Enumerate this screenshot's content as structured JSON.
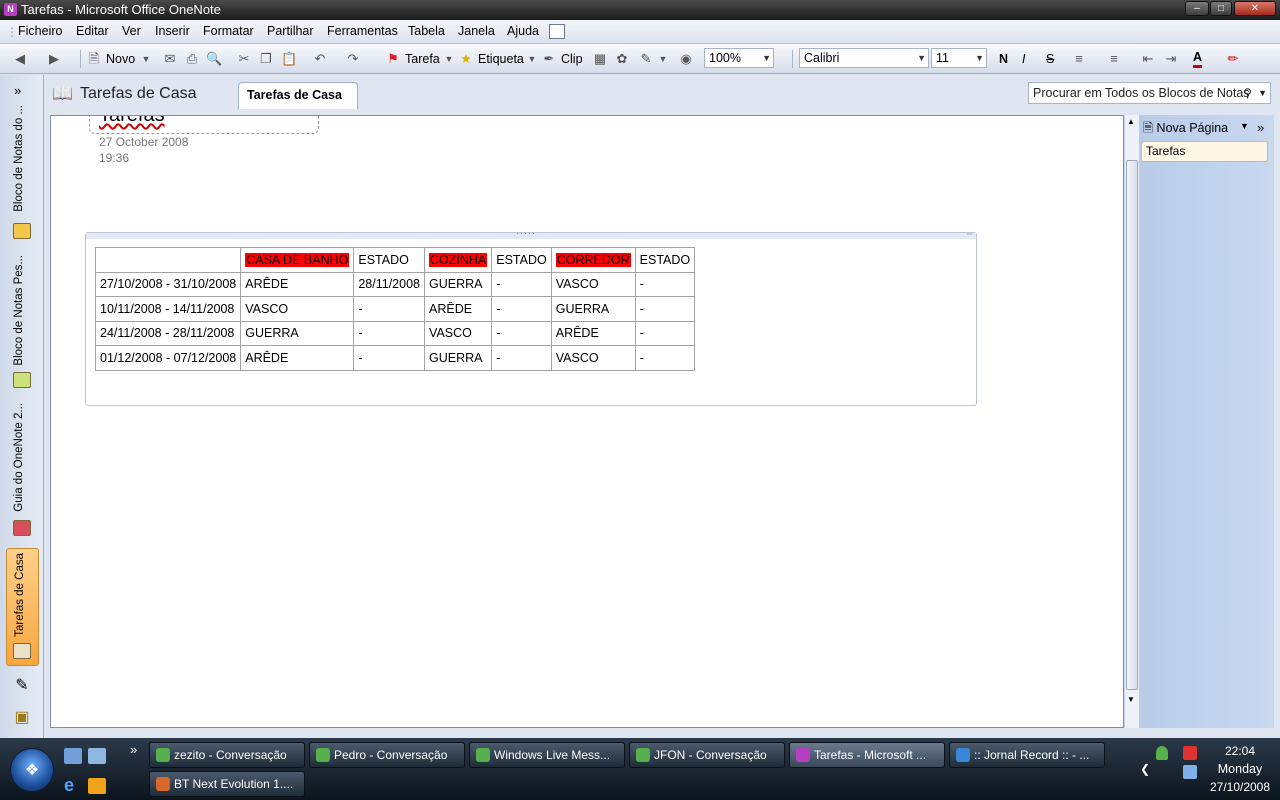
{
  "window": {
    "title": "Tarefas - Microsoft Office OneNote"
  },
  "menu": [
    "Ficheiro",
    "Editar",
    "Ver",
    "Inserir",
    "Formatar",
    "Partilhar",
    "Ferramentas",
    "Tabela",
    "Janela",
    "Ajuda"
  ],
  "toolbar": {
    "new_label": "Novo",
    "task_label": "Tarefa",
    "tag_label": "Etiqueta",
    "clip_label": "Clip",
    "zoom": "100%",
    "font": "Calibri",
    "font_size": "11",
    "bold": "N",
    "italic": "I",
    "strike": "S",
    "font_color": "A"
  },
  "notebooks": [
    {
      "label": "Bloco de Notas do ..."
    },
    {
      "label": "Bloco de Notas Pes..."
    },
    {
      "label": "Guia do OneNote 2..."
    },
    {
      "label": "Tarefas de Casa"
    }
  ],
  "header": {
    "notebook_title": "Tarefas de Casa",
    "section_tab": "Tarefas de Casa",
    "search_placeholder": "Procurar em Todos os Blocos de Notas"
  },
  "right_pane": {
    "new_page_label": "Nova Página",
    "pages": [
      "Tarefas"
    ]
  },
  "page": {
    "title": "Tarefas",
    "date": "27 October 2008",
    "time": "19:36",
    "table": {
      "headers": [
        "",
        "CASA DE BANHO",
        "ESTADO",
        "COZINHA",
        "ESTADO",
        "CORREDOR",
        "ESTADO"
      ],
      "highlight_color": "#ff0000",
      "rows": [
        [
          "27/10/2008 - 31/10/2008",
          "ARÊDE",
          "28/11/2008",
          "GUERRA",
          "-",
          "VASCO",
          "-"
        ],
        [
          "10/11/2008 - 14/11/2008",
          "VASCO",
          "-",
          "ARÊDE",
          "-",
          "GUERRA",
          "-"
        ],
        [
          "24/11/2008 - 28/11/2008",
          "GUERRA",
          "-",
          "VASCO",
          "-",
          "ARÊDE",
          "-"
        ],
        [
          "01/12/2008 - 07/12/2008",
          "ARÊDE",
          "-",
          "GUERRA",
          "-",
          "VASCO",
          "-"
        ]
      ]
    }
  },
  "taskbar": {
    "buttons": [
      {
        "label": "zezito - Conversação",
        "icon": "messenger-icon"
      },
      {
        "label": "Pedro - Conversação",
        "icon": "messenger-icon"
      },
      {
        "label": "Windows Live Mess...",
        "icon": "messenger-icon"
      },
      {
        "label": "JFON - Conversação",
        "icon": "messenger-icon"
      },
      {
        "label": "Tarefas - Microsoft ...",
        "icon": "onenote-icon"
      },
      {
        "label": ":: Jornal Record :: - ...",
        "icon": "ie-icon"
      },
      {
        "label": "BT Next Evolution 1....",
        "icon": "app-icon"
      }
    ],
    "clock": {
      "time": "22:04",
      "day": "Monday",
      "date": "27/10/2008"
    }
  }
}
